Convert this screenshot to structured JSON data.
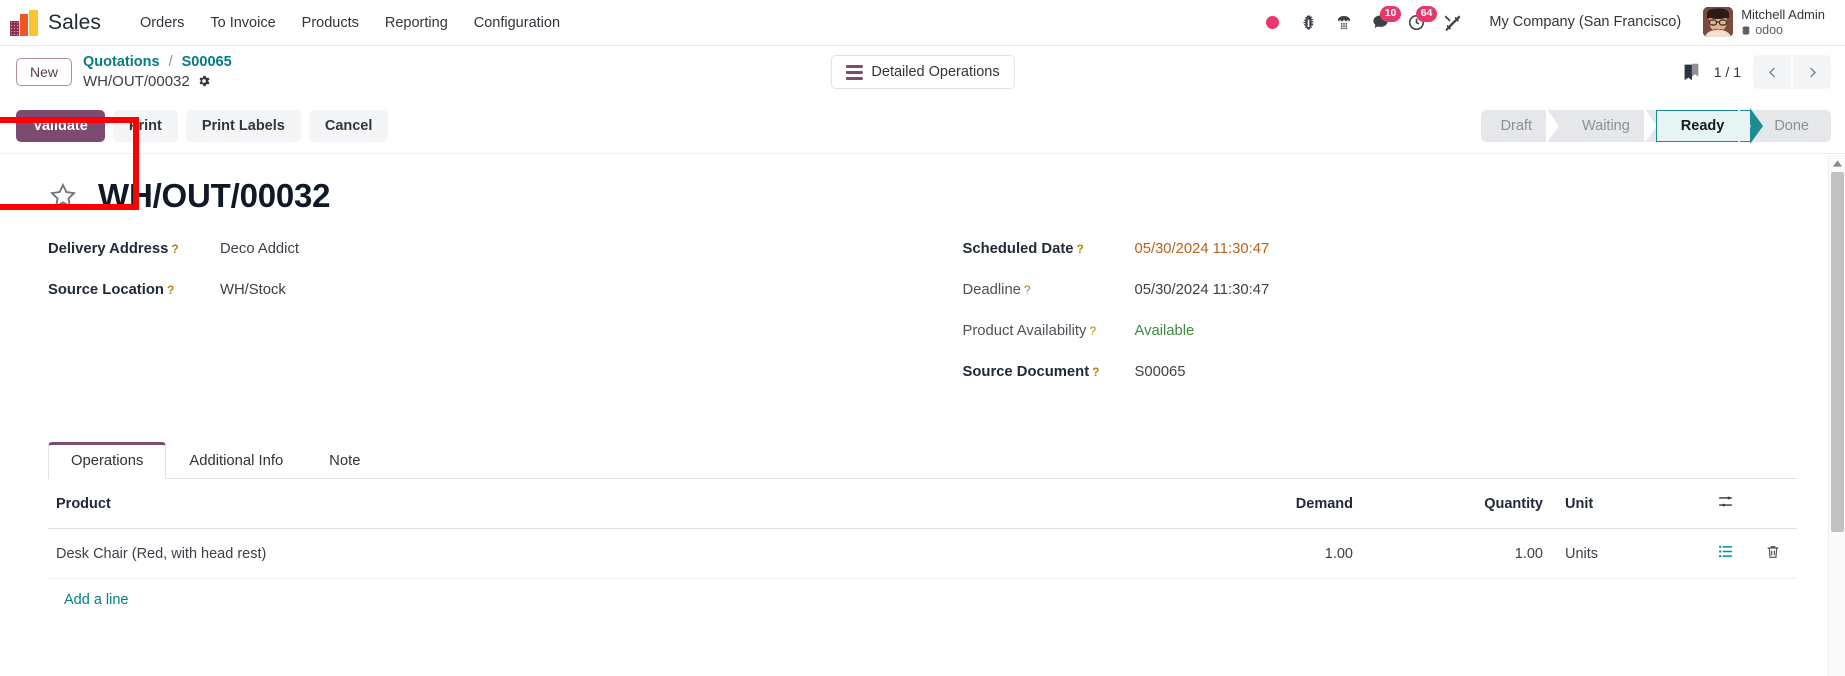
{
  "navbar": {
    "app_logo_icon": "sales-bar-chart-logo",
    "brand": "Sales",
    "menus": [
      {
        "label": "Orders"
      },
      {
        "label": "To Invoice"
      },
      {
        "label": "Products"
      },
      {
        "label": "Reporting"
      },
      {
        "label": "Configuration"
      }
    ],
    "tray": {
      "recording_dot_icon": "red-record-dot-icon",
      "bug_icon": "bug-icon",
      "dialpad_icon": "phone-dialpad-icon",
      "messages_icon": "chat-bubble-icon",
      "messages_badge": "10",
      "activities_icon": "clock-activity-icon",
      "activities_badge": "64",
      "tools_icon": "wrench-screwdriver-icon"
    },
    "company": "My Company (San Francisco)",
    "user": {
      "avatar_icon": "user-avatar",
      "name": "Mitchell Admin",
      "database_icon": "database-icon",
      "database": "odoo"
    }
  },
  "breadcrumb": {
    "new_button": "New",
    "parent": "Quotations",
    "separator": "/",
    "parent_record": "S00065",
    "current": "WH/OUT/00032",
    "gear_icon": "gear-icon"
  },
  "controlpanel": {
    "detailed_operations_icon": "list-lines-icon",
    "detailed_operations": "Detailed Operations",
    "bookmark_icon": "bookmark-icon",
    "pager": "1 / 1",
    "prev_icon": "chevron-left-icon",
    "next_icon": "chevron-right-icon"
  },
  "actions": {
    "validate": "Validate",
    "print": "Print",
    "print_labels": "Print Labels",
    "cancel": "Cancel"
  },
  "statusbar": {
    "active": "Ready",
    "steps": [
      {
        "label": "Draft"
      },
      {
        "label": "Waiting"
      },
      {
        "label": "Ready"
      },
      {
        "label": "Done"
      }
    ]
  },
  "record": {
    "favorite_icon": "star-outline-icon",
    "title": "WH/OUT/00032"
  },
  "form": {
    "left": [
      {
        "label": "Delivery Address",
        "help_icon": "question-mark-icon",
        "value": "Deco Addict",
        "bold": true
      },
      {
        "label": "Source Location",
        "help_icon": "question-mark-icon",
        "value": "WH/Stock",
        "bold": true
      }
    ],
    "right": [
      {
        "label": "Scheduled Date",
        "help_icon": "question-mark-icon",
        "value": "05/30/2024 11:30:47",
        "bold": true,
        "style": "warn"
      },
      {
        "label": "Deadline",
        "help_icon": "question-mark-icon",
        "value": "05/30/2024 11:30:47",
        "bold": false,
        "style": ""
      },
      {
        "label": "Product Availability",
        "help_icon": "question-mark-icon",
        "value": "Available",
        "bold": false,
        "style": "ok"
      },
      {
        "label": "Source Document",
        "help_icon": "question-mark-icon",
        "value": "S00065",
        "bold": true,
        "style": ""
      }
    ]
  },
  "tabs": {
    "active": "Operations",
    "items": [
      {
        "label": "Operations"
      },
      {
        "label": "Additional Info"
      },
      {
        "label": "Note"
      }
    ]
  },
  "table": {
    "headers": {
      "product": "Product",
      "demand": "Demand",
      "quantity": "Quantity",
      "unit": "Unit",
      "options_icon": "sliders-settings-icon"
    },
    "rows": [
      {
        "product": "Desk Chair (Red, with head rest)",
        "demand": "1.00",
        "quantity": "1.00",
        "unit": "Units",
        "detail_icon": "list-detail-icon",
        "delete_icon": "trash-icon"
      }
    ],
    "add_line": "Add a line"
  },
  "scrollbar": {
    "up_icon": "scroll-up-arrow-icon"
  },
  "colors": {
    "primary": "#7d4a70",
    "link": "#017e84",
    "accent_teal": "#1d8c91",
    "warn": "#b8621b",
    "success": "#3b8a3f",
    "badge": "#e8376b",
    "annotation": "#ff0000"
  }
}
